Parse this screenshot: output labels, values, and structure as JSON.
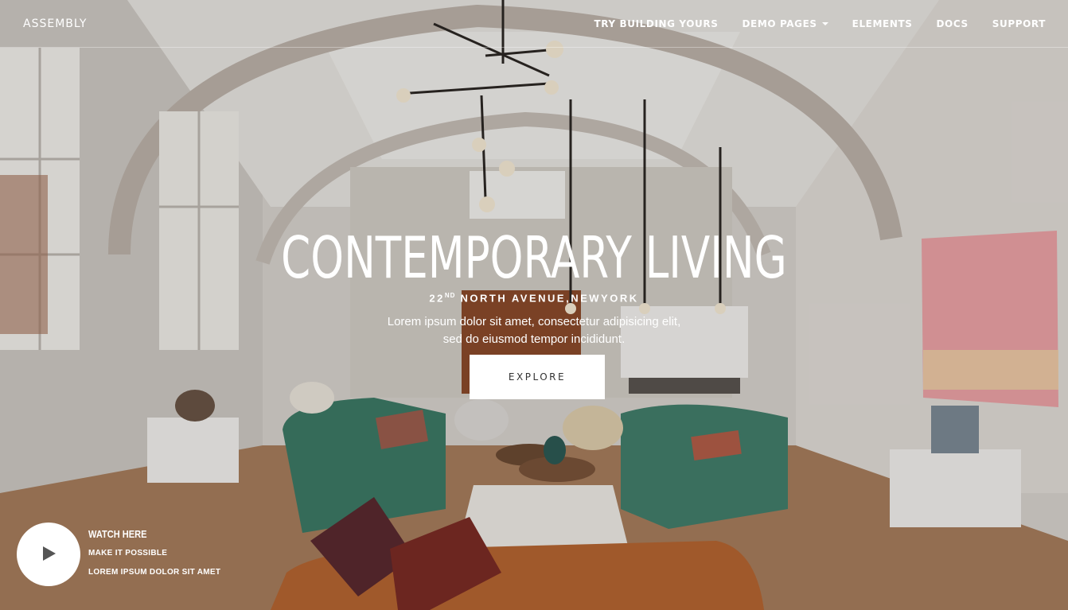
{
  "nav": {
    "logo": "ASSEMBLY",
    "items": [
      {
        "label": "TRY BUILDING YOURS"
      },
      {
        "label": "DEMO PAGES"
      },
      {
        "label": "ELEMENTS"
      },
      {
        "label": "DOCS"
      },
      {
        "label": "SUPPORT"
      }
    ]
  },
  "hero": {
    "title": "CONTEMPORARY LIVING",
    "subtitle_num": "22",
    "subtitle_sup": "ND",
    "subtitle_rest": " NORTH AVENUE,NEWYORK",
    "lead_line1": "Lorem ipsum dolor sit amet, consectetur adipisicing elit,",
    "lead_line2": "sed do eiusmod tempor incididunt.",
    "button": "EXPLORE"
  },
  "watch": {
    "title": "WATCH HERE",
    "line1": "MAKE IT POSSIBLE",
    "line2": "LOREM IPSUM DOLOR SIT AMET",
    "icon": "play-icon"
  }
}
